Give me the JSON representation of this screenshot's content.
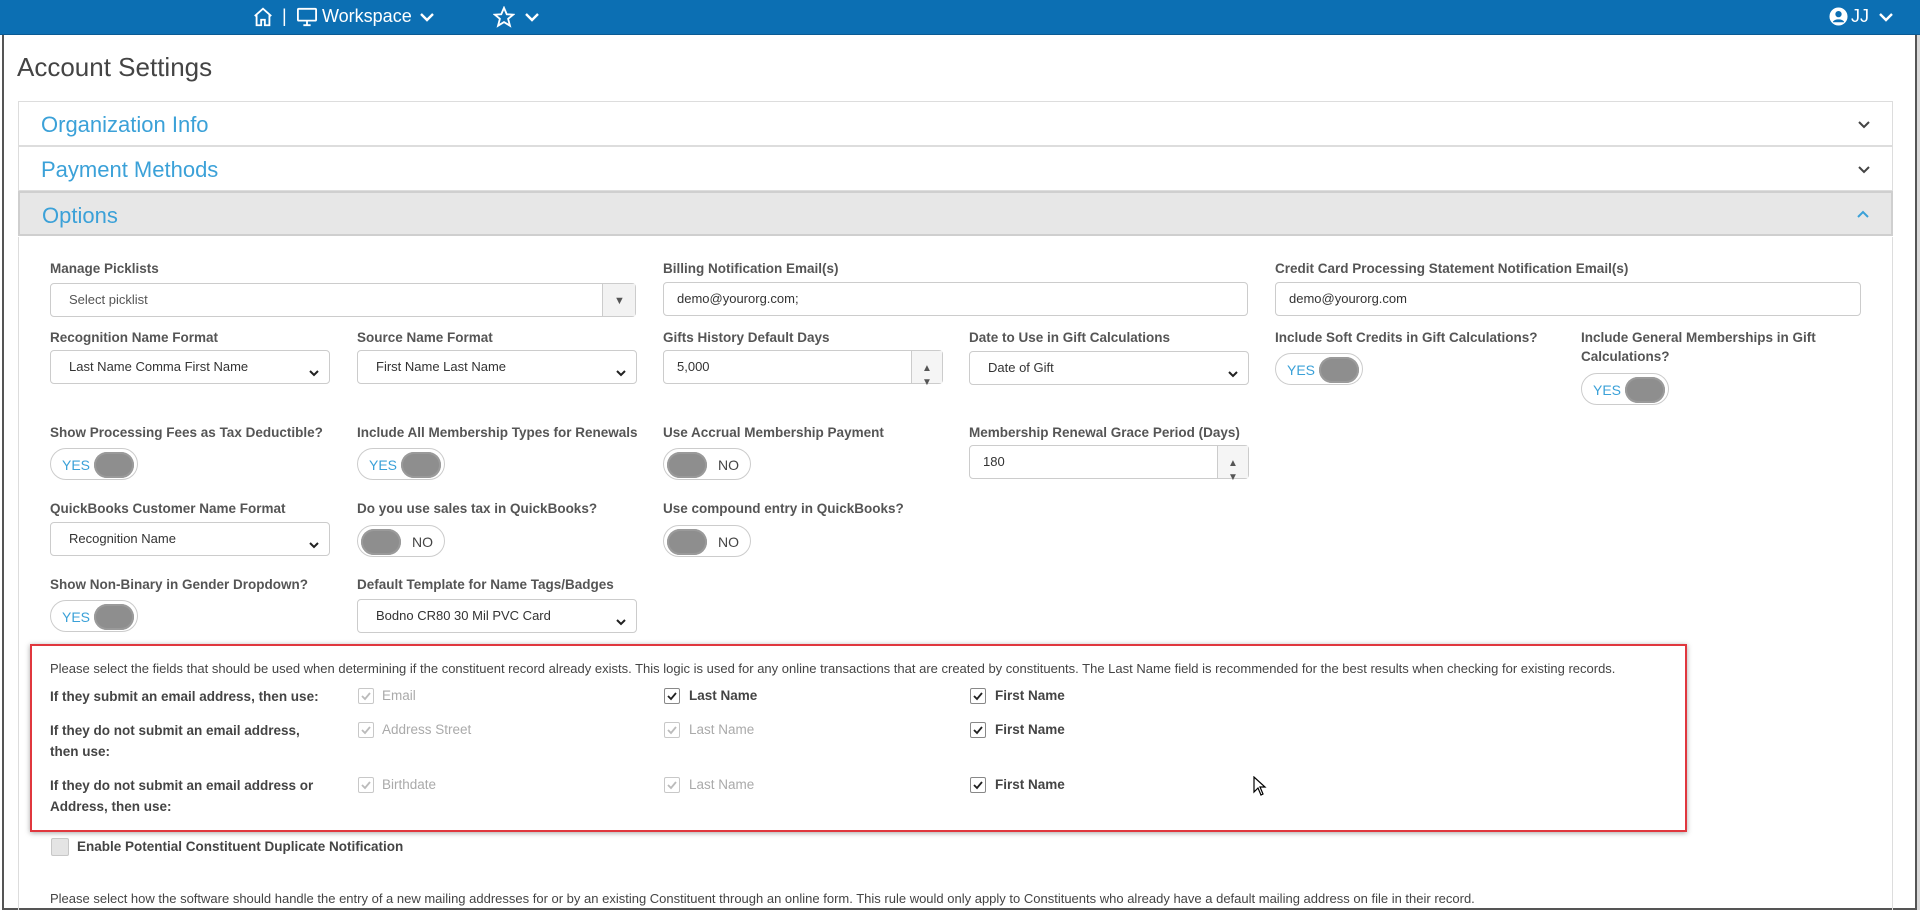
{
  "topbar": {
    "home_icon": "home-icon",
    "separator": "|",
    "workspace_label": "Workspace",
    "favorites_icon": "star-icon",
    "user_initials": "JJ"
  },
  "page": {
    "title": "Account Settings"
  },
  "sections": {
    "org_info": "Organization Info",
    "payment_methods": "Payment Methods",
    "options": "Options"
  },
  "fields": {
    "manage_picklists": {
      "label": "Manage Picklists",
      "placeholder": "Select picklist"
    },
    "billing_email": {
      "label": "Billing Notification Email(s)",
      "value": "demo@yourorg.com;"
    },
    "cc_email": {
      "label": "Credit Card Processing Statement Notification Email(s)",
      "value": "demo@yourorg.com"
    },
    "recognition_format": {
      "label": "Recognition Name Format",
      "value": "Last Name Comma First Name"
    },
    "source_format": {
      "label": "Source Name Format",
      "value": "First Name Last Name"
    },
    "gifts_history": {
      "label": "Gifts History Default Days",
      "value": "5,000"
    },
    "date_gift_calc": {
      "label": "Date to Use in Gift Calculations",
      "value": "Date of Gift"
    },
    "soft_credits": {
      "label": "Include Soft Credits in Gift Calculations?",
      "state": "YES"
    },
    "general_memberships": {
      "label": "Include General Memberships in Gift Calculations?",
      "state": "YES"
    },
    "processing_fees": {
      "label": "Show Processing Fees as Tax Deductible?",
      "state": "YES"
    },
    "all_membership_types": {
      "label": "Include All Membership Types for Renewals",
      "state": "YES"
    },
    "accrual_membership": {
      "label": "Use Accrual Membership Payment",
      "state": "NO"
    },
    "renewal_grace": {
      "label": "Membership Renewal Grace Period (Days)",
      "value": "180"
    },
    "qb_customer_format": {
      "label": "QuickBooks Customer Name Format",
      "value": "Recognition Name"
    },
    "qb_sales_tax": {
      "label": "Do you use sales tax in QuickBooks?",
      "state": "NO"
    },
    "qb_compound": {
      "label": "Use compound entry in QuickBooks?",
      "state": "NO"
    },
    "non_binary": {
      "label": "Show Non-Binary in Gender Dropdown?",
      "state": "YES"
    },
    "name_tag_template": {
      "label": "Default Template for Name Tags/Badges",
      "value": "Bodno CR80 30 Mil PVC Card"
    }
  },
  "duplicate_check": {
    "note": "Please select the fields that should be used when determining if the constituent record already exists. This logic is used for any online transactions that are created by constituents. The Last Name field is recommended for the best results when checking for existing records.",
    "rows": [
      {
        "label": "If they submit an email address, then use:",
        "c1": "Email",
        "c2": "Last Name",
        "c3": "First Name"
      },
      {
        "label": "If they do not submit an email address, then use:",
        "c1": "Address Street",
        "c2": "Last Name",
        "c3": "First Name"
      },
      {
        "label": "If they do not submit an email address or Address, then use:",
        "c1": "Birthdate",
        "c2": "Last Name",
        "c3": "First Name"
      }
    ]
  },
  "duplicate_notification": {
    "label": "Enable Potential Constituent Duplicate Notification"
  },
  "mailing_note": "Please select how the software should handle the entry of a new mailing addresses for or by an existing Constituent through an online form. This rule would only apply to Constituents who already have a default mailing address on file in their record."
}
